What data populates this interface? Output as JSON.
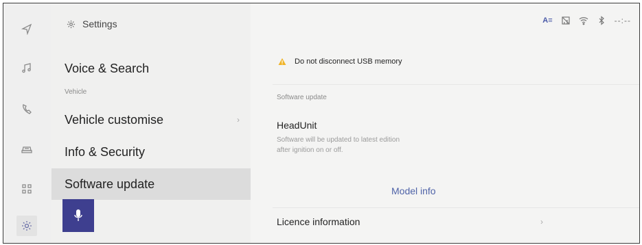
{
  "header": {
    "title": "Settings"
  },
  "rail": {
    "items": [
      {
        "icon": "navigation-arrow-icon"
      },
      {
        "icon": "music-note-icon"
      },
      {
        "icon": "phone-icon"
      },
      {
        "icon": "car-icon"
      },
      {
        "icon": "apps-grid-icon"
      },
      {
        "icon": "gear-icon",
        "active": true
      }
    ]
  },
  "menu": {
    "voice_search": "Voice & Search",
    "section_vehicle": "Vehicle",
    "vehicle_customise": "Vehicle customise",
    "info_security": "Info & Security",
    "software_update": "Software update"
  },
  "status": {
    "az_label": "A≡",
    "clock": "--:--"
  },
  "content": {
    "warning": "Do not disconnect USB memory",
    "section_label": "Software update",
    "headunit_title": "HeadUnit",
    "headunit_desc_1": "Software will be updated to latest edition",
    "headunit_desc_2": "after ignition on or off.",
    "model_info": "Model info",
    "licence": "Licence information"
  },
  "colors": {
    "accent": "#3e3f8f",
    "link": "#4f63a8",
    "warning": "#f0b429"
  }
}
